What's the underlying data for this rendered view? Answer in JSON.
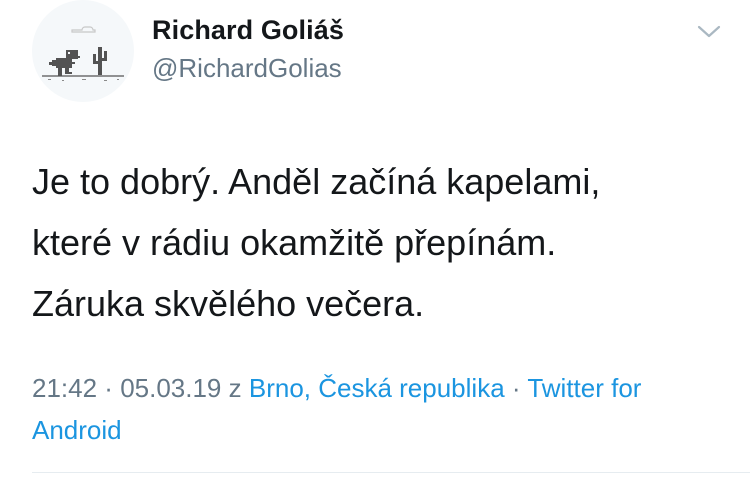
{
  "user": {
    "display_name": "Richard Goliáš",
    "handle": "@RichardGolias",
    "avatar_icon": "dino-cactus-icon"
  },
  "tweet": {
    "lines": [
      "Je to dobrý. Anděl začíná kapelami,",
      "které v rádiu okamžitě přepínám.",
      "Záruka skvělého večera."
    ]
  },
  "meta": {
    "time": "21:42",
    "sep1": " · ",
    "date": "05.03.19",
    "from_word": " z ",
    "location": "Brno, Česká republika",
    "sep2": " · ",
    "client": "Twitter for Android"
  },
  "colors": {
    "text": "#14171a",
    "secondary": "#657786",
    "link": "#1b95e0"
  }
}
